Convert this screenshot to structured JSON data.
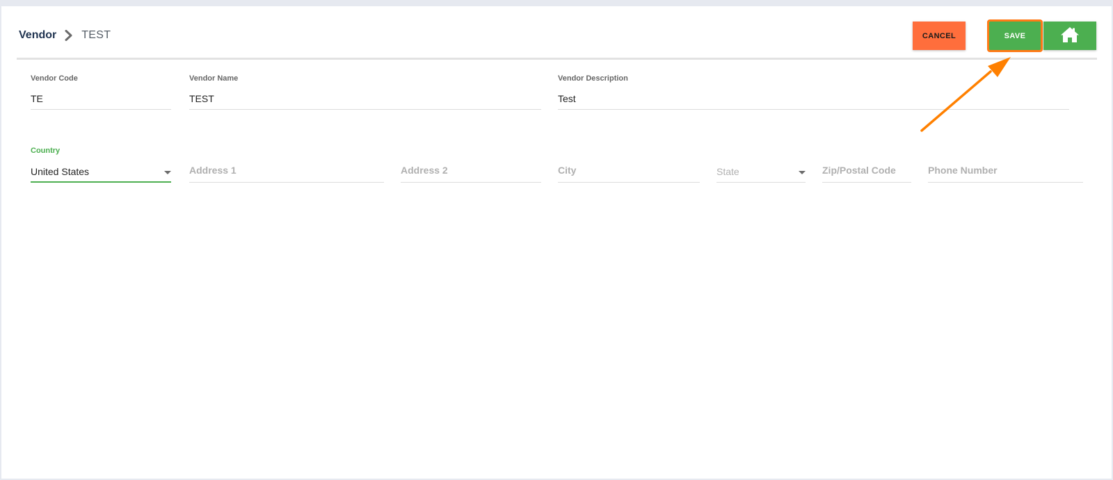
{
  "breadcrumb": {
    "root": "Vendor",
    "separator_icon": "chevron-right-icon",
    "current": "TEST"
  },
  "toolbar": {
    "cancel_label": "CANCEL",
    "save_label": "SAVE",
    "home_icon": "home-icon"
  },
  "colors": {
    "cancel": "#ff6e3c",
    "save": "#4caf50",
    "home": "#4caf50",
    "highlight": "#ff7a16",
    "active_field": "#4caf50"
  },
  "form": {
    "vendor_code": {
      "label": "Vendor Code",
      "value": "TE"
    },
    "vendor_name": {
      "label": "Vendor Name",
      "value": "TEST"
    },
    "vendor_description": {
      "label": "Vendor Description",
      "value": "Test"
    },
    "country": {
      "label": "Country",
      "value": "United States"
    },
    "address1": {
      "placeholder": "Address 1"
    },
    "address2": {
      "placeholder": "Address 2"
    },
    "city": {
      "placeholder": "City"
    },
    "state": {
      "placeholder": "State"
    },
    "zip": {
      "placeholder": "Zip/Postal Code"
    },
    "phone": {
      "placeholder": "Phone Number"
    }
  }
}
